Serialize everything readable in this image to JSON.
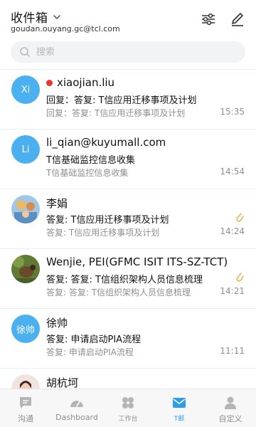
{
  "header": {
    "folder_name": "收件箱",
    "account": "goudan.ouyang.gc@tcl.com"
  },
  "search": {
    "placeholder": "搜索"
  },
  "mails": [
    {
      "avatar_text": "Xi",
      "sender": "xiaojian.liu",
      "unread": true,
      "subject": "回复：答复: T信应用迁移事项及计划",
      "preview": "回复：答复: T信应用迁移事项及计划",
      "time": "15:35",
      "attachment": false
    },
    {
      "avatar_text": "Li",
      "sender": "li_qian@kuyumall.com",
      "unread": false,
      "subject": "T信基础监控信息收集",
      "preview": "T信基础监控信息收集",
      "time": "14:54",
      "attachment": false
    },
    {
      "avatar_text": "",
      "sender": "李娟",
      "unread": false,
      "subject": "答复: T信应用迁移事项及计划",
      "preview": "答复: T信应用迁移事项及计划",
      "time": "14:24",
      "attachment": true
    },
    {
      "avatar_text": "",
      "sender": "Wenjie, PEI(GFMC ISIT ITS-SZ-TCT)",
      "unread": false,
      "subject": "答复: 答复: T信组织架构人员信息梳理",
      "preview": "答复: 答复: T信组织架构人员信息梳理",
      "time": "14:21",
      "attachment": true
    },
    {
      "avatar_text": "徐帅",
      "sender": "徐帅",
      "unread": false,
      "subject": "答复: 申请启动PIA流程",
      "preview": "答复: 申请启动PIA流程",
      "time": "11:11",
      "attachment": false
    },
    {
      "avatar_text": "",
      "sender": "胡杭坷",
      "unread": false,
      "subject": "",
      "preview": "",
      "time": "",
      "attachment": false
    }
  ],
  "tabs": [
    {
      "label": "沟通",
      "icon": "chat-icon",
      "active": false
    },
    {
      "label": "Dashboard",
      "icon": "gauge-icon",
      "active": false
    },
    {
      "label": "工作台",
      "icon": "workbench-icon",
      "active": false
    },
    {
      "label": "T邮",
      "icon": "mail-icon",
      "active": true
    },
    {
      "label": "自定义",
      "icon": "person-icon",
      "active": false
    }
  ],
  "colors": {
    "accent": "#2b9cf0",
    "avatar_blue": "#4ab0ef",
    "unread_dot": "#e8372f",
    "attachment": "#e9b45c",
    "muted_text": "#8f8f8f"
  }
}
